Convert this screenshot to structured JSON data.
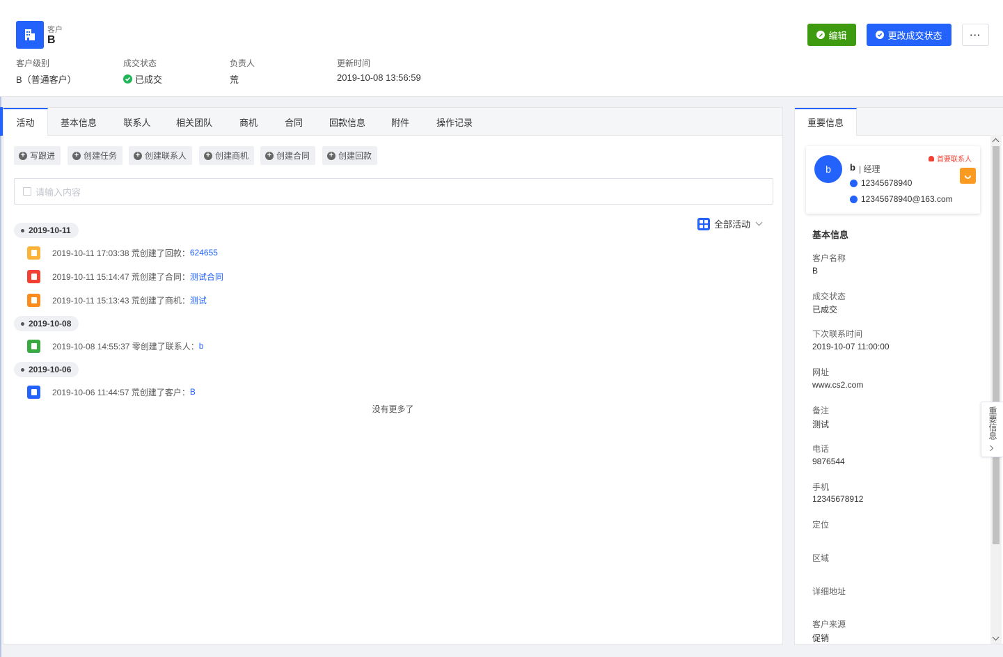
{
  "header": {
    "type_label": "客户",
    "name": "B",
    "meta": [
      {
        "label": "客户级别",
        "value": "B（普通客户）"
      },
      {
        "label": "成交状态",
        "value": "已成交"
      },
      {
        "label": "负责人",
        "value": "荒"
      },
      {
        "label": "更新时间",
        "value": "2019-10-08 13:56:59"
      }
    ],
    "edit_label": "编辑",
    "status_label": "更改成交状态",
    "more_label": "···"
  },
  "tabs": [
    "活动",
    "基本信息",
    "联系人",
    "相关团队",
    "商机",
    "合同",
    "回款信息",
    "附件",
    "操作记录"
  ],
  "actions": [
    "写跟进",
    "创建任务",
    "创建联系人",
    "创建商机",
    "创建合同",
    "创建回款"
  ],
  "input": {
    "placeholder": "请输入内容"
  },
  "filter_label": "全部活动",
  "timeline": [
    {
      "date": "2019-10-11",
      "logs": [
        {
          "text": "2019-10-11 17:03:38 荒创建了回款：",
          "link": "624655",
          "color": "#fbb33c"
        },
        {
          "text": "2019-10-11 15:14:47 荒创建了合同：",
          "link": "测试合同",
          "color": "#f04134"
        },
        {
          "text": "2019-10-11 15:13:43 荒创建了商机：",
          "link": "测试",
          "color": "#fa8c1e"
        }
      ]
    },
    {
      "date": "2019-10-08",
      "logs": [
        {
          "text": "2019-10-08 14:55:37 零创建了联系人：",
          "link": "b",
          "color": "#3aa942"
        }
      ]
    },
    {
      "date": "2019-10-06",
      "logs": [
        {
          "text": "2019-10-06 11:44:57 荒创建了客户：",
          "link": "B",
          "color": "#2362fb"
        }
      ]
    }
  ],
  "no_more": "没有更多了",
  "side": {
    "tab": "重要信息",
    "contact": {
      "avatar": "b",
      "name": "b",
      "title": "| 经理",
      "tag": "首要联系人",
      "mobile": "12345678940",
      "email": "12345678940@163.com"
    },
    "section_title": "基本信息",
    "fields": [
      {
        "label": "客户名称",
        "value": "B"
      },
      {
        "label": "成交状态",
        "value": "已成交"
      },
      {
        "label": "下次联系时间",
        "value": "2019-10-07 11:00:00"
      },
      {
        "label": "网址",
        "value": "www.cs2.com"
      },
      {
        "label": "备注",
        "value": "测试"
      },
      {
        "label": "电话",
        "value": "9876544"
      },
      {
        "label": "手机",
        "value": "12345678912"
      },
      {
        "label": "定位",
        "value": ""
      },
      {
        "label": "区域",
        "value": ""
      },
      {
        "label": "详细地址",
        "value": ""
      },
      {
        "label": "客户来源",
        "value": "促销"
      }
    ],
    "float_tab": "重要信息"
  },
  "colors": {
    "primary": "#2362fb",
    "success": "#3e9b0f",
    "status_ok": "#20b559",
    "danger": "#f04134",
    "warning": "#fa9a21"
  }
}
